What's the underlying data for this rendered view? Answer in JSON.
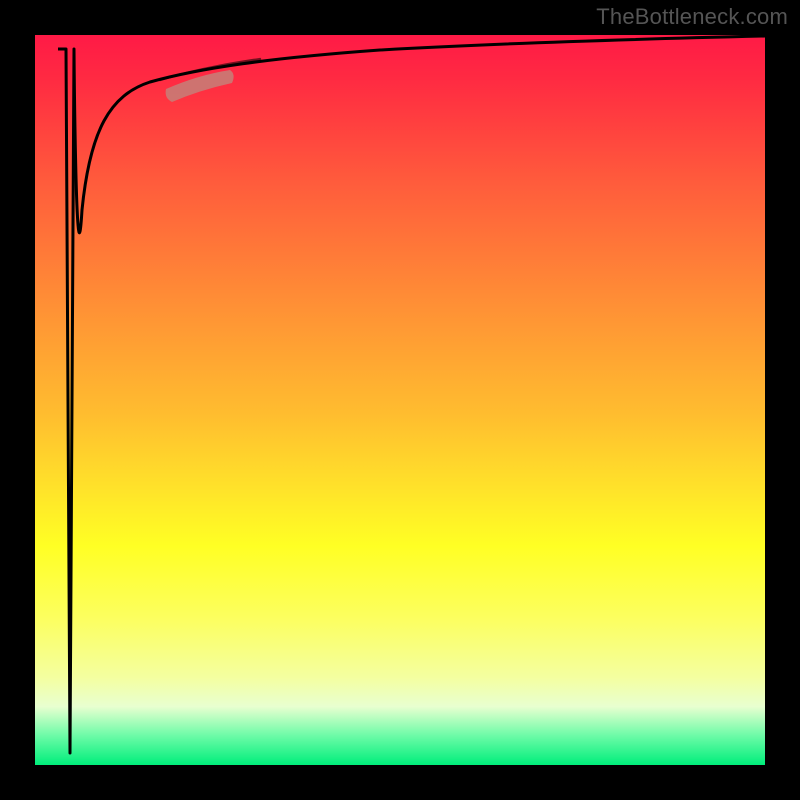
{
  "attribution": "TheBottleneck.com",
  "chart_data": {
    "type": "line",
    "title": "",
    "xlabel": "",
    "ylabel": "",
    "xlim": [
      0,
      100
    ],
    "ylim": [
      0,
      100
    ],
    "background_gradient": {
      "direction": "top-to-bottom",
      "stops": [
        {
          "pos": 0,
          "color": "#ff1a46"
        },
        {
          "pos": 50,
          "color": "#ffbd2f"
        },
        {
          "pos": 70,
          "color": "#ffff24"
        },
        {
          "pos": 96,
          "color": "#6cfba7"
        },
        {
          "pos": 100,
          "color": "#00ee7b"
        }
      ]
    },
    "series": [
      {
        "name": "spike-down",
        "x": [
          4.3,
          4.8,
          5.3
        ],
        "y": [
          98,
          2,
          98
        ],
        "color": "#000000"
      },
      {
        "name": "log-curve",
        "x": [
          5.3,
          6,
          7,
          8,
          10,
          12,
          15,
          18,
          22,
          28,
          35,
          45,
          60,
          80,
          100
        ],
        "y": [
          2,
          50,
          70,
          78,
          84,
          87,
          89.5,
          91,
          92.2,
          93.3,
          94.2,
          95,
          95.8,
          96.4,
          96.8
        ],
        "color": "#000000"
      }
    ],
    "highlight": {
      "name": "marker-blob",
      "approx_x_range": [
        18,
        26
      ],
      "approx_y_range": [
        90.5,
        92.8
      ],
      "color": "#c97b76"
    }
  }
}
